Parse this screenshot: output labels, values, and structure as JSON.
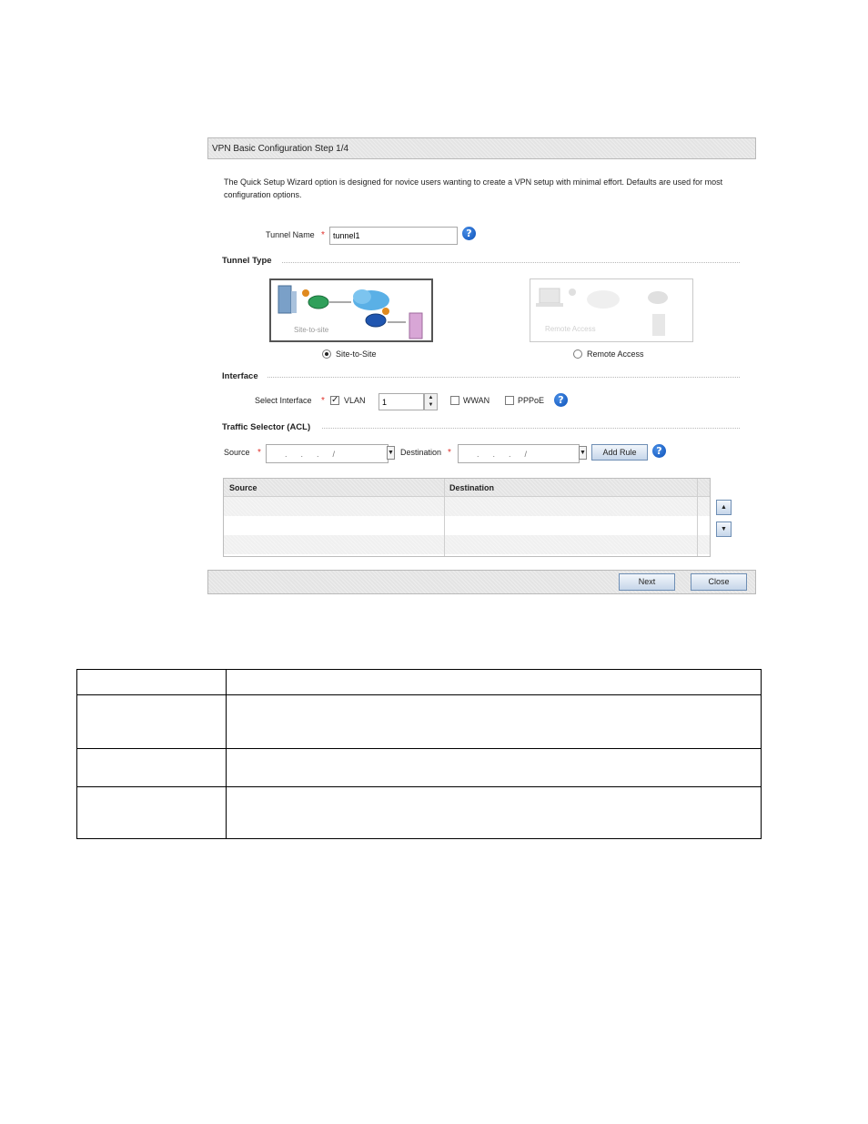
{
  "wizard": {
    "header_title": "VPN Basic Configuration  Step 1/4",
    "intro": "The Quick Setup Wizard option is designed for novice users wanting to create a VPN setup with minimal effort. Defaults are used for most configuration options.",
    "tunnel_name_label": "Tunnel Name",
    "tunnel_name_value": "tunnel1",
    "tunnel_type_title": "Tunnel Type",
    "tile_site_caption": "Site-to-site",
    "tile_remote_caption": "Remote Access",
    "radio_site_label": "Site-to-Site",
    "radio_remote_label": "Remote Access",
    "interface_title": "Interface",
    "select_interface_label": "Select Interface",
    "vlan_label": "VLAN",
    "vlan_value": "1",
    "wwan_label": "WWAN",
    "pppoe_label": "PPPoE",
    "traffic_title": "Traffic Selector (ACL)",
    "source_label": "Source",
    "source_ip_placeholder": ".      .      .      /",
    "destination_label": "Destination",
    "destination_ip_placeholder": ".      .      .      /",
    "add_rule_label": "Add Rule",
    "grid_headers": [
      "Source",
      "Destination"
    ],
    "next_label": "Next",
    "close_label": "Close",
    "required_mark": "*",
    "help_glyph": "?"
  },
  "doc_table": {
    "rows": 4,
    "columns": 2
  },
  "colors": {
    "accent": "#0a4fb8",
    "required": "#e0302a",
    "panel": "#e4e4e4"
  }
}
